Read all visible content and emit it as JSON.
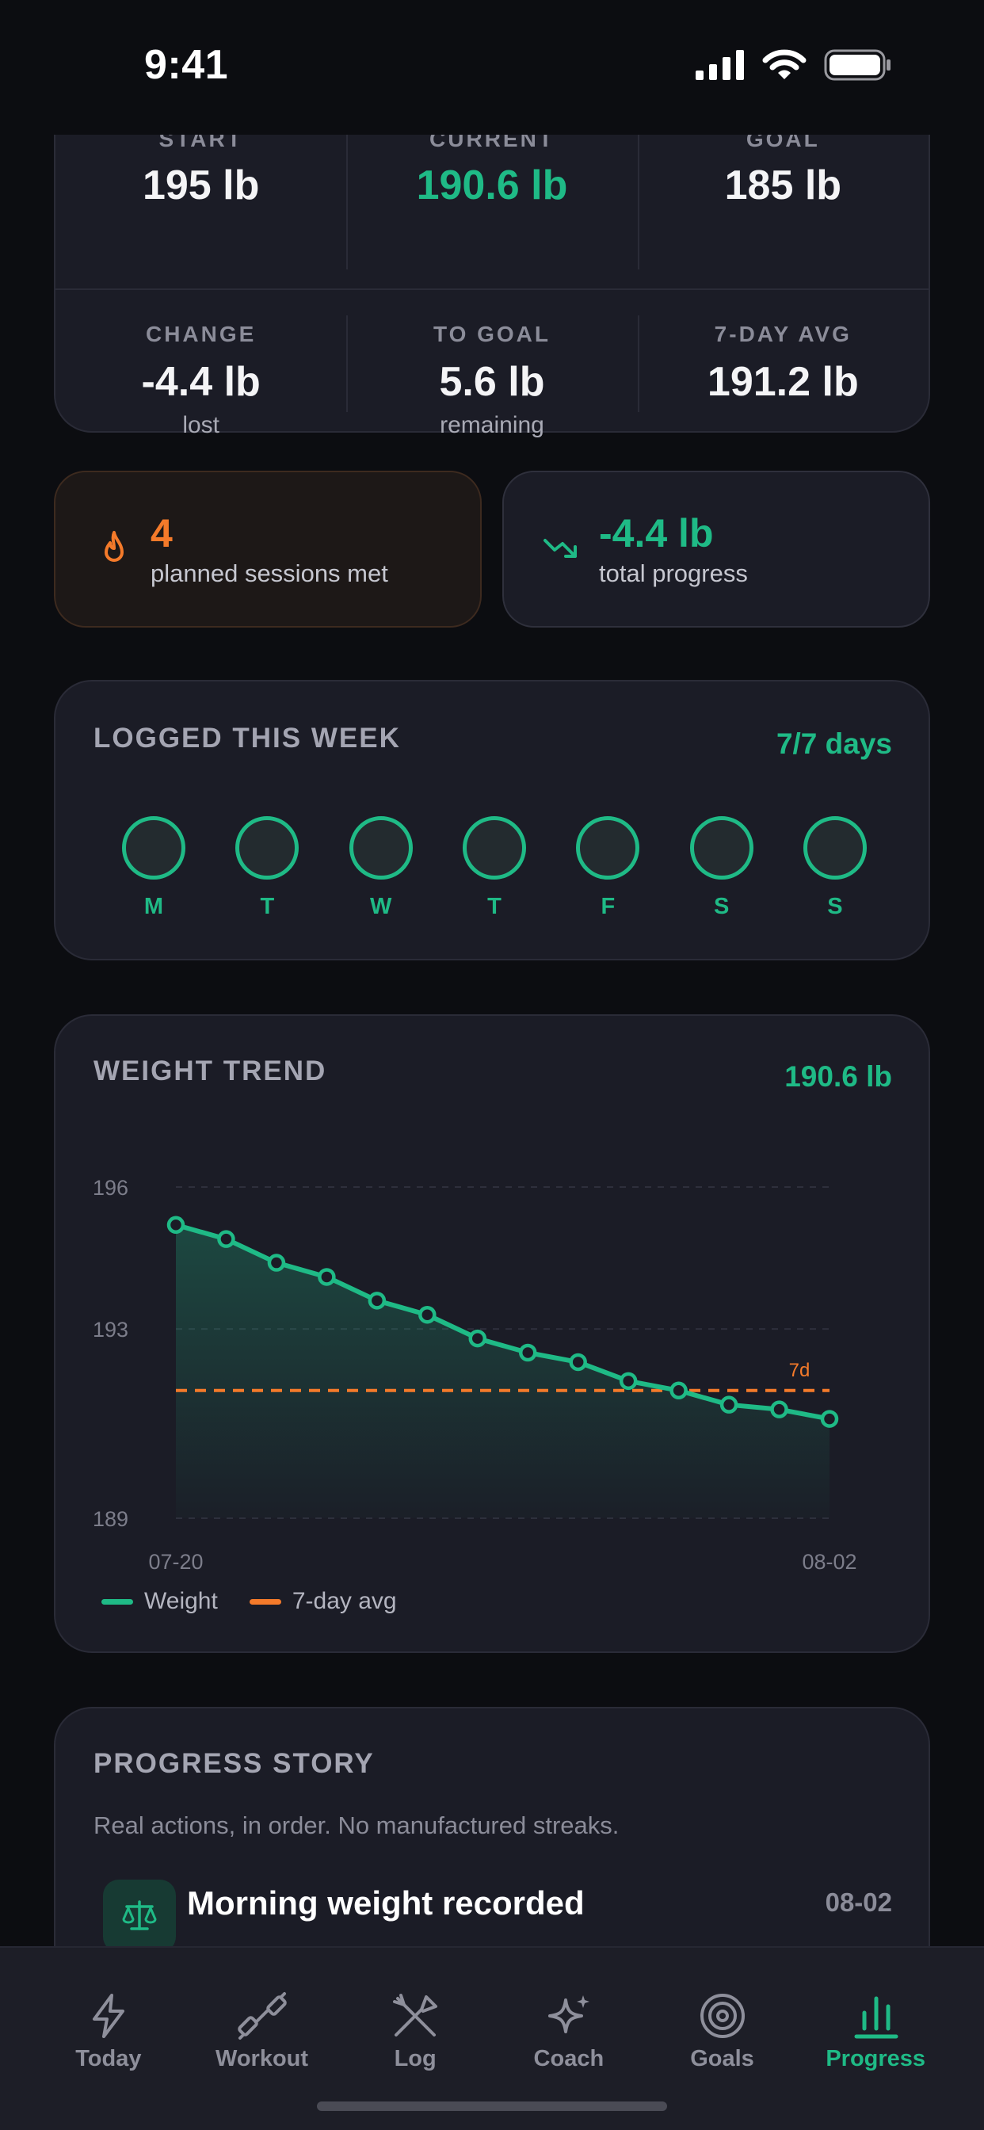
{
  "status_bar": {
    "time": "9:41"
  },
  "stats": {
    "row1": [
      {
        "label": "START",
        "value": "195 lb"
      },
      {
        "label": "CURRENT",
        "value": "190.6 lb"
      },
      {
        "label": "GOAL",
        "value": "185 lb"
      }
    ],
    "row2": [
      {
        "label": "CHANGE",
        "value": "-4.4 lb",
        "sub": "lost"
      },
      {
        "label": "TO GOAL",
        "value": "5.6 lb",
        "sub": "remaining"
      },
      {
        "label": "7-DAY AVG",
        "value": "191.2 lb",
        "sub": ""
      }
    ]
  },
  "tiles": {
    "sessions": {
      "value": "4",
      "label": "planned sessions met",
      "icon": "flame-icon",
      "color": "#f47a2a"
    },
    "progress": {
      "value": "-4.4 lb",
      "label": "total progress",
      "icon": "trending-down-icon",
      "color": "#1fba86"
    }
  },
  "week": {
    "title": "LOGGED THIS WEEK",
    "summary": "7/7 days",
    "days": [
      "M",
      "T",
      "W",
      "T",
      "F",
      "S",
      "S"
    ]
  },
  "trend": {
    "title": "WEIGHT TREND",
    "current": "190.6 lb",
    "avg_label": "7d",
    "legend": {
      "weight": "Weight",
      "avg": "7-day avg"
    }
  },
  "chart_data": {
    "type": "line",
    "x": [
      "07-20",
      "07-21",
      "07-22",
      "07-23",
      "07-24",
      "07-25",
      "07-26",
      "07-27",
      "07-28",
      "07-29",
      "07-30",
      "07-31",
      "08-01",
      "08-02"
    ],
    "x_tick_labels": [
      "07-20",
      "08-02"
    ],
    "y_ticks": [
      196,
      193,
      189
    ],
    "ylim": [
      189,
      196
    ],
    "series": [
      {
        "name": "Weight",
        "values": [
          195.2,
          194.9,
          194.4,
          194.1,
          193.6,
          193.3,
          192.8,
          192.5,
          192.3,
          191.9,
          191.7,
          191.4,
          191.3,
          191.1
        ],
        "color": "#1fba86"
      },
      {
        "name": "7-day avg",
        "values": [
          191.7
        ],
        "style": "dashed-horizontal",
        "color": "#f47a2a"
      }
    ],
    "grid": true,
    "legend_position": "bottom-left"
  },
  "story": {
    "title": "PROGRESS STORY",
    "subtitle": "Real actions, in order. No manufactured streaks.",
    "items": [
      {
        "title": "Morning weight recorded",
        "date": "08-02",
        "icon": "scale-icon"
      }
    ]
  },
  "tabs": [
    {
      "label": "Today",
      "icon": "bolt-icon",
      "active": false
    },
    {
      "label": "Workout",
      "icon": "dumbbell-icon",
      "active": false
    },
    {
      "label": "Log",
      "icon": "fork-knife-icon",
      "active": false
    },
    {
      "label": "Coach",
      "icon": "sparkle-icon",
      "active": false
    },
    {
      "label": "Goals",
      "icon": "target-icon",
      "active": false
    },
    {
      "label": "Progress",
      "icon": "bar-chart-icon",
      "active": true
    }
  ],
  "colors": {
    "accent": "#1fba86",
    "orange": "#f47a2a",
    "background": "#0c0d11",
    "card": "#1b1c26"
  }
}
